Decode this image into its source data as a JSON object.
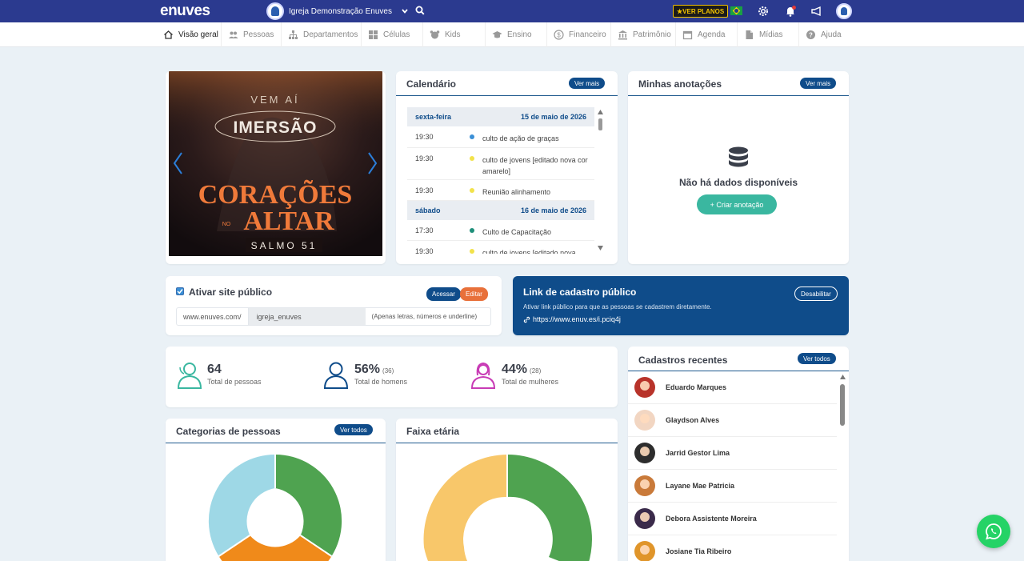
{
  "app": {
    "logo": "enuves",
    "church_name": "Igreja Demonstração Enuves",
    "plans_label": "★VER PLANOS"
  },
  "nav": [
    {
      "label": "Visão geral",
      "icon": "home-icon"
    },
    {
      "label": "Pessoas",
      "icon": "people-icon"
    },
    {
      "label": "Departamentos",
      "icon": "sitemap-icon"
    },
    {
      "label": "Células",
      "icon": "grid-icon"
    },
    {
      "label": "Kids",
      "icon": "kids-icon"
    },
    {
      "label": "Ensino",
      "icon": "graduation-icon"
    },
    {
      "label": "Financeiro",
      "icon": "dollar-icon"
    },
    {
      "label": "Patrimônio",
      "icon": "bank-icon"
    },
    {
      "label": "Agenda",
      "icon": "calendar-icon"
    },
    {
      "label": "Mídias",
      "icon": "file-icon"
    },
    {
      "label": "Ajuda",
      "icon": "help-icon"
    }
  ],
  "banner": {
    "line1": "VEM AÍ",
    "line2": "IMERSÃO",
    "line3": "CORAÇÕES",
    "line4_small": "NO",
    "line4": "ALTAR",
    "line5": "SALMO 51"
  },
  "calendar": {
    "title": "Calendário",
    "more_label": "Ver mais",
    "days": [
      {
        "weekday": "sexta-feira",
        "date": "15 de maio de 2026",
        "events": [
          {
            "time": "19:30",
            "title": "culto de ação de graças",
            "color": "#3a8fd6"
          },
          {
            "time": "19:30",
            "title": "culto de jovens [editado nova cor amarelo]",
            "color": "#f2e24a"
          },
          {
            "time": "19:30",
            "title": "Reunião alinhamento",
            "color": "#f2e24a"
          }
        ]
      },
      {
        "weekday": "sábado",
        "date": "16 de maio de 2026",
        "events": [
          {
            "time": "17:30",
            "title": "Culto de Capacitação",
            "color": "#1e8f7a"
          },
          {
            "time": "19:30",
            "title": "culto de jovens [editado nova",
            "color": "#f2e24a"
          }
        ]
      }
    ]
  },
  "notes": {
    "title": "Minhas anotações",
    "more_label": "Ver mais",
    "empty_text": "Não há dados disponíveis",
    "create_label": "+ Criar anotação"
  },
  "public_site": {
    "title": "Ativar site público",
    "access_label": "Acessar",
    "edit_label": "Editar",
    "domain_prefix": "www.enuves.com/",
    "slug": "igreja_enuves",
    "hint": "(Apenas letras, números e underline)"
  },
  "public_link": {
    "title": "Link de cadastro público",
    "disable_label": "Desabilitar",
    "description": "Ativar link público para que as pessoas se cadastrem diretamente.",
    "url": "https://www.enuv.es/i.pciq4j"
  },
  "stats": [
    {
      "value": "64",
      "count": "",
      "label": "Total de pessoas",
      "color": "#3ab7a0"
    },
    {
      "value": "56%",
      "count": "(36)",
      "label": "Total de homens",
      "color": "#0f4c8a"
    },
    {
      "value": "44%",
      "count": "(28)",
      "label": "Total de mulheres",
      "color": "#c83bb5"
    }
  ],
  "categories_card": {
    "title": "Categorias de pessoas",
    "more_label": "Ver todos"
  },
  "age_card": {
    "title": "Faixa etária"
  },
  "recent": {
    "title": "Cadastros recentes",
    "more_label": "Ver todos",
    "people": [
      {
        "name": "Eduardo Marques",
        "color": "#b8332a"
      },
      {
        "name": "Glaydson Alves",
        "color": "#f2d6c2"
      },
      {
        "name": "Jarrid Gestor Lima",
        "color": "#2d2d2d"
      },
      {
        "name": "Layane Mae Patricia",
        "color": "#c97a3a"
      },
      {
        "name": "Debora Assistente Moreira",
        "color": "#3a2a4a"
      },
      {
        "name": "Josiane Tia Ribeiro",
        "color": "#e0952a"
      }
    ]
  },
  "colors": {
    "topbar": "#2b3a8f",
    "accent": "#0f4c8a",
    "teal": "#3ab7a0",
    "orange": "#e8703a",
    "green_chart": "#4fa350",
    "orange_chart": "#f08a1a",
    "lightblue_chart": "#9ed8e6",
    "yellow_chart": "#f8c76a",
    "lightgreen_chart": "#8fd46a"
  }
}
